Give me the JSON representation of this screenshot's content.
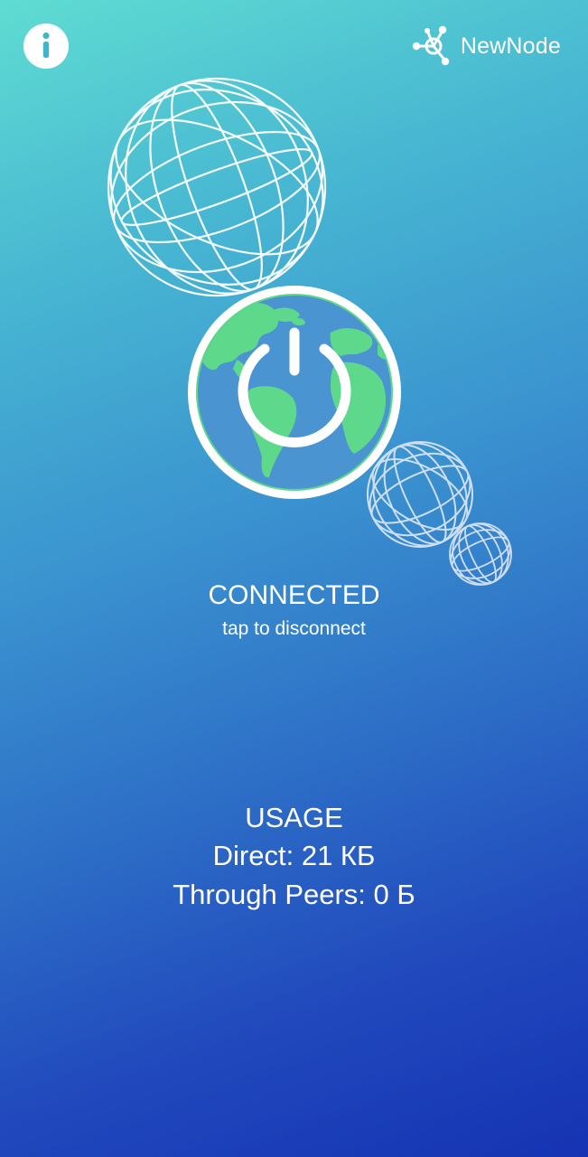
{
  "header": {
    "info_icon": "info-icon",
    "logo_icon": "network-nodes-icon",
    "logo_text": "NewNode"
  },
  "status": {
    "title": "CONNECTED",
    "hint": "tap to disconnect"
  },
  "usage": {
    "title": "USAGE",
    "direct": "Direct: 21 КБ",
    "peers": "Through Peers: 0 Б"
  },
  "colors": {
    "background_top": "#5fdcd2",
    "background_bottom": "#1533b3",
    "globe_ocean": "#4a95d1",
    "globe_land": "#5ed88b",
    "white": "#ffffff"
  }
}
